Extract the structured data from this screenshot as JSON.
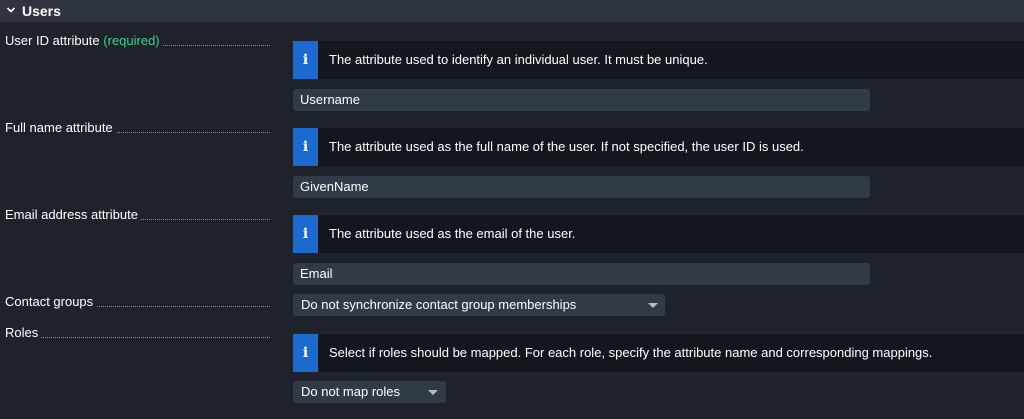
{
  "section": {
    "title": "Users"
  },
  "fields": {
    "user_id": {
      "label": "User ID attribute",
      "required": "(required)",
      "help": "The attribute used to identify an individual user. It must be unique.",
      "value": "Username"
    },
    "full_name": {
      "label": "Full name attribute",
      "help": "The attribute used as the full name of the user. If not specified, the user ID is used.",
      "value": "GivenName"
    },
    "email": {
      "label": "Email address attribute",
      "help": "The attribute used as the email of the user.",
      "value": "Email"
    },
    "contact_groups": {
      "label": "Contact groups",
      "selected": "Do not synchronize contact group memberships"
    },
    "roles": {
      "label": "Roles",
      "help": "Select if roles should be mapped. For each role, specify the attribute name and corresponding mappings.",
      "selected": "Do not map roles"
    }
  },
  "icons": {
    "collapse": "chevron-down-icon",
    "info": "info-icon"
  },
  "colors": {
    "background": "#1e232b",
    "header": "#2e3540",
    "info_background": "#13171d",
    "info_icon": "#1a6ad0",
    "input": "#313a47",
    "required": "#3fd08a"
  }
}
